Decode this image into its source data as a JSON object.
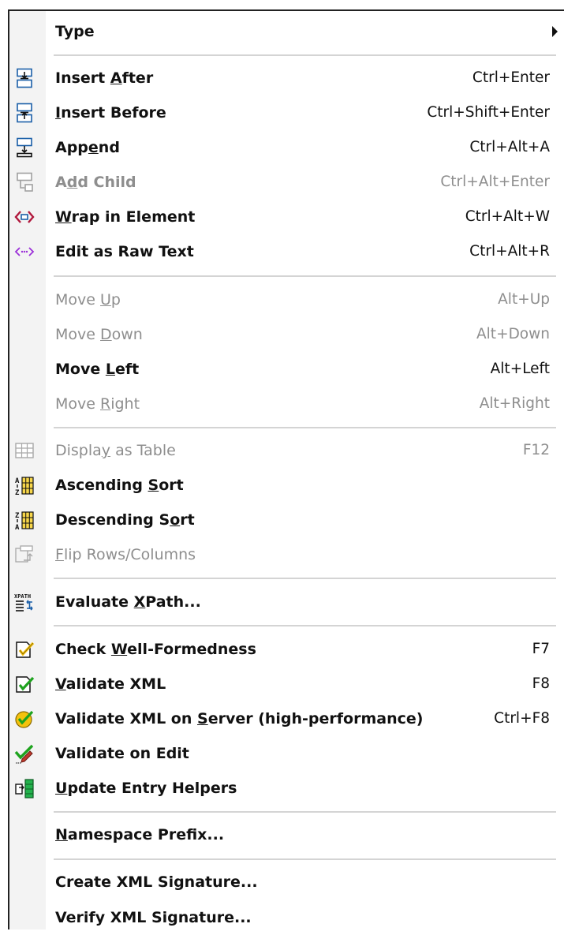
{
  "menu": {
    "type": {
      "label": "Type"
    },
    "insert_after": {
      "pre": "Insert ",
      "u": "A",
      "post": "fter",
      "shortcut": "Ctrl+Enter"
    },
    "insert_before": {
      "pre": "",
      "u": "I",
      "post": "nsert Before",
      "shortcut": "Ctrl+Shift+Enter"
    },
    "append": {
      "pre": "App",
      "u": "e",
      "post": "nd",
      "shortcut": "Ctrl+Alt+A"
    },
    "add_child": {
      "pre": "A",
      "u": "d",
      "post": "d Child",
      "shortcut": "Ctrl+Alt+Enter"
    },
    "wrap": {
      "pre": "",
      "u": "W",
      "post": "rap in Element",
      "shortcut": "Ctrl+Alt+W"
    },
    "raw_text": {
      "label": "Edit as Raw Text",
      "shortcut": "Ctrl+Alt+R"
    },
    "move_up": {
      "pre": "Move ",
      "u": "U",
      "post": "p",
      "shortcut": "Alt+Up"
    },
    "move_down": {
      "pre": "Move ",
      "u": "D",
      "post": "own",
      "shortcut": "Alt+Down"
    },
    "move_left": {
      "pre": "Move ",
      "u": "L",
      "post": "eft",
      "shortcut": "Alt+Left"
    },
    "move_right": {
      "pre": "Move ",
      "u": "R",
      "post": "ight",
      "shortcut": "Alt+Right"
    },
    "display_table": {
      "pre": "Displa",
      "u": "y",
      "post": " as Table",
      "shortcut": "F12"
    },
    "asc_sort": {
      "pre": "Ascending ",
      "u": "S",
      "post": "ort"
    },
    "desc_sort": {
      "pre": "Descending S",
      "u": "o",
      "post": "rt"
    },
    "flip": {
      "pre": "",
      "u": "F",
      "post": "lip Rows/Columns"
    },
    "xpath": {
      "pre": "Evaluate ",
      "u": "X",
      "post": "Path..."
    },
    "check_wf": {
      "pre": "Check ",
      "u": "W",
      "post": "ell-Formedness",
      "shortcut": "F7"
    },
    "validate": {
      "pre": "",
      "u": "V",
      "post": "alidate XML",
      "shortcut": "F8"
    },
    "validate_server": {
      "pre": "Validate XML on ",
      "u": "S",
      "post": "erver (high-performance)",
      "shortcut": "Ctrl+F8"
    },
    "validate_edit": {
      "label": "Validate on Edit"
    },
    "entry_helpers": {
      "pre": "",
      "u": "U",
      "post": "pdate Entry Helpers"
    },
    "ns_prefix": {
      "pre": "",
      "u": "N",
      "post": "amespace Prefix..."
    },
    "create_sig": {
      "label": "Create XML Signature..."
    },
    "verify_sig": {
      "label": "Verify XML Signature..."
    }
  },
  "icons": {
    "insert_after": "insert-after-icon",
    "insert_before": "insert-before-icon",
    "append": "append-icon",
    "add_child": "add-child-icon",
    "wrap": "wrap-element-icon",
    "raw_text": "raw-text-icon",
    "display_table": "table-icon",
    "asc_sort": "ascending-sort-icon",
    "desc_sort": "descending-sort-icon",
    "flip": "flip-icon",
    "xpath": "xpath-icon",
    "check_wf": "check-wellformed-icon",
    "validate": "validate-icon",
    "validate_server": "validate-server-icon",
    "validate_edit": "validate-edit-icon",
    "entry_helpers": "entry-helpers-icon"
  },
  "colors": {
    "disabled_text": "#8e8e8e",
    "text": "#111111",
    "icon_blue": "#1b5fa8",
    "wrap_red": "#b0183c",
    "raw_purple": "#9b30d8",
    "check_green": "#1ea31e",
    "check_yellow": "#f4c20d",
    "helper_green": "#22b14c"
  }
}
